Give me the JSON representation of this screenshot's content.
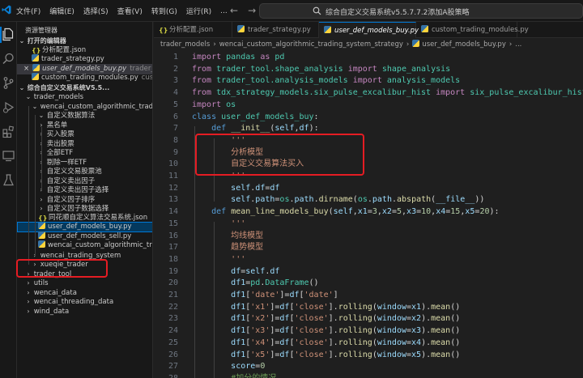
{
  "menu": [
    "文件(F)",
    "编辑(E)",
    "选择(S)",
    "查看(V)",
    "转到(G)",
    "运行(R)",
    "..."
  ],
  "command_center": "综合自定义交易系统v5.5.7.7.2添加A股策略",
  "sidebar": {
    "title": "资源管理器",
    "rows": [
      {
        "kind": "section",
        "chev": "v",
        "label": "打开的编辑器"
      },
      {
        "kind": "open",
        "icon": "json",
        "label": "分析配置.json"
      },
      {
        "kind": "open",
        "icon": "py",
        "label": "trader_strategy.py"
      },
      {
        "kind": "open-active",
        "icon": "py",
        "label": "user_def_models_buy.py",
        "sub": "trader_..."
      },
      {
        "kind": "open",
        "icon": "py",
        "label": "custom_trading_modules.py",
        "sub": "cus..."
      },
      {
        "kind": "section",
        "chev": "v",
        "label": "综合自定义交易系统V5.5..."
      },
      {
        "kind": "folder",
        "level": 1,
        "chev": "v",
        "label": "trader_models"
      },
      {
        "kind": "folder",
        "level": 2,
        "chev": "v",
        "label": "wencai_custom_algorithmic_trading..."
      },
      {
        "kind": "folder",
        "level": 3,
        "chev": "v",
        "label": "自定义数据算法"
      },
      {
        "kind": "folder",
        "level": 3,
        "chev": ">",
        "label": "黑名单"
      },
      {
        "kind": "folder",
        "level": 3,
        "chev": ">",
        "label": "买入股票"
      },
      {
        "kind": "folder",
        "level": 3,
        "chev": ">",
        "label": "卖出股票"
      },
      {
        "kind": "folder",
        "level": 3,
        "chev": ">",
        "label": "全部ETF"
      },
      {
        "kind": "folder",
        "level": 3,
        "chev": ">",
        "label": "剔除一样ETF"
      },
      {
        "kind": "folder",
        "level": 3,
        "chev": ">",
        "label": "自定义交易股票池"
      },
      {
        "kind": "folder",
        "level": 3,
        "chev": ">",
        "label": "自定义卖出因子"
      },
      {
        "kind": "folder",
        "level": 3,
        "chev": ">",
        "label": "自定义卖出因子选择"
      },
      {
        "kind": "folder",
        "level": 3,
        "chev": ">",
        "label": "自定义因子排序"
      },
      {
        "kind": "folder",
        "level": 3,
        "chev": ">",
        "label": "自定义因子数据选择"
      },
      {
        "kind": "file",
        "level": 3,
        "icon": "json",
        "label": "同花顺自定义算法交易系统.json"
      },
      {
        "kind": "file-selected",
        "level": 3,
        "icon": "py",
        "label": "user_def_models_buy.py"
      },
      {
        "kind": "file",
        "level": 3,
        "icon": "py",
        "label": "user_def_models_sell.py"
      },
      {
        "kind": "file",
        "level": 3,
        "icon": "py",
        "label": "wencai_custom_algorithmic_tradin..."
      },
      {
        "kind": "folder",
        "level": 2,
        "chev": ">",
        "label": "wencai_trading_system"
      },
      {
        "kind": "folder",
        "level": 2,
        "chev": ">",
        "label": "xueqie_trader"
      },
      {
        "kind": "folder",
        "level": 1,
        "chev": ">",
        "label": "trader_tool"
      },
      {
        "kind": "folder",
        "level": 1,
        "chev": ">",
        "label": "utils"
      },
      {
        "kind": "folder",
        "level": 1,
        "chev": ">",
        "label": "wencai_data"
      },
      {
        "kind": "folder",
        "level": 1,
        "chev": ">",
        "label": "wencai_threading_data"
      },
      {
        "kind": "folder",
        "level": 1,
        "chev": ">",
        "label": "wind_data"
      }
    ]
  },
  "tabs": [
    {
      "label": "分析配置.json",
      "icon": "json",
      "active": false
    },
    {
      "label": "trader_strategy.py",
      "icon": "py",
      "active": false
    },
    {
      "label": "user_def_models_buy.py",
      "icon": "py",
      "active": true
    },
    {
      "label": "custom_trading_modules.py",
      "icon": "py",
      "active": false
    }
  ],
  "breadcrumb": [
    "trader_models",
    "wencai_custom_algorithmic_trading_system_strategy",
    "user_def_models_buy.py",
    "..."
  ],
  "code": [
    {
      "n": "1",
      "t": [
        [
          "k-purple",
          "import"
        ],
        [
          "k-plain",
          " "
        ],
        [
          "k-cls",
          "pandas"
        ],
        [
          "k-plain",
          " "
        ],
        [
          "k-purple",
          "as"
        ],
        [
          "k-plain",
          " "
        ],
        [
          "k-cls",
          "pd"
        ]
      ]
    },
    {
      "n": "2",
      "t": [
        [
          "k-purple",
          "from"
        ],
        [
          "k-plain",
          " "
        ],
        [
          "k-cls",
          "trader_tool.shape_analysis"
        ],
        [
          "k-plain",
          " "
        ],
        [
          "k-purple",
          "import"
        ],
        [
          "k-plain",
          " "
        ],
        [
          "k-cls",
          "shape_analysis"
        ]
      ]
    },
    {
      "n": "3",
      "t": [
        [
          "k-purple",
          "from"
        ],
        [
          "k-plain",
          " "
        ],
        [
          "k-cls",
          "trader_tool.analysis_models"
        ],
        [
          "k-plain",
          " "
        ],
        [
          "k-purple",
          "import"
        ],
        [
          "k-plain",
          " "
        ],
        [
          "k-cls",
          "analysis_models"
        ]
      ]
    },
    {
      "n": "4",
      "t": [
        [
          "k-purple",
          "from"
        ],
        [
          "k-plain",
          " "
        ],
        [
          "k-cls",
          "tdx_strategy_models.six_pulse_excalibur_hist"
        ],
        [
          "k-plain",
          " "
        ],
        [
          "k-purple",
          "import"
        ],
        [
          "k-plain",
          " "
        ],
        [
          "k-cls",
          "six_pulse_excalibur_hist"
        ]
      ]
    },
    {
      "n": "5",
      "t": [
        [
          "k-purple",
          "import"
        ],
        [
          "k-plain",
          " "
        ],
        [
          "k-cls",
          "os"
        ]
      ]
    },
    {
      "n": "6",
      "t": [
        [
          "k-blue",
          "class"
        ],
        [
          "k-plain",
          " "
        ],
        [
          "k-cls",
          "user_def_models_buy"
        ],
        [
          "k-plain",
          ":"
        ]
      ]
    },
    {
      "n": "7",
      "t": [
        [
          "k-plain",
          "    "
        ],
        [
          "k-blue",
          "def"
        ],
        [
          "k-plain",
          " "
        ],
        [
          "k-fn",
          "__init__"
        ],
        [
          "k-plain",
          "("
        ],
        [
          "k-var",
          "self"
        ],
        [
          "k-plain",
          ","
        ],
        [
          "k-var",
          "df"
        ],
        [
          "k-plain",
          "):"
        ]
      ]
    },
    {
      "n": "8",
      "t": [
        [
          "k-plain",
          "        "
        ],
        [
          "k-str",
          "'''"
        ]
      ]
    },
    {
      "n": "9",
      "t": [
        [
          "k-plain",
          "        "
        ],
        [
          "k-str",
          "分析模型"
        ]
      ]
    },
    {
      "n": "10",
      "t": [
        [
          "k-plain",
          "        "
        ],
        [
          "k-str",
          "自定义交易算法买入"
        ]
      ]
    },
    {
      "n": "11",
      "t": [
        [
          "k-plain",
          "        "
        ],
        [
          "k-str",
          "'''"
        ]
      ]
    },
    {
      "n": "12",
      "t": [
        [
          "k-plain",
          "        "
        ],
        [
          "k-var",
          "self"
        ],
        [
          "k-plain",
          "."
        ],
        [
          "k-var",
          "df"
        ],
        [
          "k-plain",
          "="
        ],
        [
          "k-var",
          "df"
        ]
      ]
    },
    {
      "n": "13",
      "t": [
        [
          "k-plain",
          "        "
        ],
        [
          "k-var",
          "self"
        ],
        [
          "k-plain",
          "."
        ],
        [
          "k-var",
          "path"
        ],
        [
          "k-plain",
          "="
        ],
        [
          "k-cls",
          "os"
        ],
        [
          "k-plain",
          "."
        ],
        [
          "k-var",
          "path"
        ],
        [
          "k-plain",
          "."
        ],
        [
          "k-fn",
          "dirname"
        ],
        [
          "k-plain",
          "("
        ],
        [
          "k-cls",
          "os"
        ],
        [
          "k-plain",
          "."
        ],
        [
          "k-var",
          "path"
        ],
        [
          "k-plain",
          "."
        ],
        [
          "k-fn",
          "abspath"
        ],
        [
          "k-plain",
          "("
        ],
        [
          "k-var",
          "__file__"
        ],
        [
          "k-plain",
          "))"
        ]
      ]
    },
    {
      "n": "14",
      "t": [
        [
          "k-plain",
          "    "
        ],
        [
          "k-blue",
          "def"
        ],
        [
          "k-plain",
          " "
        ],
        [
          "k-fn",
          "mean_line_models_buy"
        ],
        [
          "k-plain",
          "("
        ],
        [
          "k-var",
          "self"
        ],
        [
          "k-plain",
          ","
        ],
        [
          "k-var",
          "x1"
        ],
        [
          "k-plain",
          "="
        ],
        [
          "k-num",
          "3"
        ],
        [
          "k-plain",
          ","
        ],
        [
          "k-var",
          "x2"
        ],
        [
          "k-plain",
          "="
        ],
        [
          "k-num",
          "5"
        ],
        [
          "k-plain",
          ","
        ],
        [
          "k-var",
          "x3"
        ],
        [
          "k-plain",
          "="
        ],
        [
          "k-num",
          "10"
        ],
        [
          "k-plain",
          ","
        ],
        [
          "k-var",
          "x4"
        ],
        [
          "k-plain",
          "="
        ],
        [
          "k-num",
          "15"
        ],
        [
          "k-plain",
          ","
        ],
        [
          "k-var",
          "x5"
        ],
        [
          "k-plain",
          "="
        ],
        [
          "k-num",
          "20"
        ],
        [
          "k-plain",
          "):"
        ]
      ]
    },
    {
      "n": "15",
      "t": [
        [
          "k-plain",
          "        "
        ],
        [
          "k-str",
          "'''"
        ]
      ]
    },
    {
      "n": "16",
      "t": [
        [
          "k-plain",
          "        "
        ],
        [
          "k-str",
          "均线模型"
        ]
      ]
    },
    {
      "n": "17",
      "t": [
        [
          "k-plain",
          "        "
        ],
        [
          "k-str",
          "趋势模型"
        ]
      ]
    },
    {
      "n": "18",
      "t": [
        [
          "k-plain",
          "        "
        ],
        [
          "k-str",
          "'''"
        ]
      ]
    },
    {
      "n": "19",
      "t": [
        [
          "k-plain",
          "        "
        ],
        [
          "k-var",
          "df"
        ],
        [
          "k-plain",
          "="
        ],
        [
          "k-var",
          "self"
        ],
        [
          "k-plain",
          "."
        ],
        [
          "k-var",
          "df"
        ]
      ]
    },
    {
      "n": "20",
      "t": [
        [
          "k-plain",
          "        "
        ],
        [
          "k-var",
          "df1"
        ],
        [
          "k-plain",
          "="
        ],
        [
          "k-cls",
          "pd"
        ],
        [
          "k-plain",
          "."
        ],
        [
          "k-cls",
          "DataFrame"
        ],
        [
          "k-plain",
          "()"
        ]
      ]
    },
    {
      "n": "21",
      "t": [
        [
          "k-plain",
          "        "
        ],
        [
          "k-var",
          "df1"
        ],
        [
          "k-plain",
          "["
        ],
        [
          "k-str",
          "'date'"
        ],
        [
          "k-plain",
          "]="
        ],
        [
          "k-var",
          "df"
        ],
        [
          "k-plain",
          "["
        ],
        [
          "k-str",
          "'date'"
        ],
        [
          "k-plain",
          "]"
        ]
      ]
    },
    {
      "n": "22",
      "t": [
        [
          "k-plain",
          "        "
        ],
        [
          "k-var",
          "df1"
        ],
        [
          "k-plain",
          "["
        ],
        [
          "k-str",
          "'x1'"
        ],
        [
          "k-plain",
          "]="
        ],
        [
          "k-var",
          "df"
        ],
        [
          "k-plain",
          "["
        ],
        [
          "k-str",
          "'close'"
        ],
        [
          "k-plain",
          "]."
        ],
        [
          "k-fn",
          "rolling"
        ],
        [
          "k-plain",
          "("
        ],
        [
          "k-var",
          "window"
        ],
        [
          "k-plain",
          "="
        ],
        [
          "k-var",
          "x1"
        ],
        [
          "k-plain",
          ")."
        ],
        [
          "k-fn",
          "mean"
        ],
        [
          "k-plain",
          "()"
        ]
      ]
    },
    {
      "n": "23",
      "t": [
        [
          "k-plain",
          "        "
        ],
        [
          "k-var",
          "df1"
        ],
        [
          "k-plain",
          "["
        ],
        [
          "k-str",
          "'x2'"
        ],
        [
          "k-plain",
          "]="
        ],
        [
          "k-var",
          "df"
        ],
        [
          "k-plain",
          "["
        ],
        [
          "k-str",
          "'close'"
        ],
        [
          "k-plain",
          "]."
        ],
        [
          "k-fn",
          "rolling"
        ],
        [
          "k-plain",
          "("
        ],
        [
          "k-var",
          "window"
        ],
        [
          "k-plain",
          "="
        ],
        [
          "k-var",
          "x2"
        ],
        [
          "k-plain",
          ")."
        ],
        [
          "k-fn",
          "mean"
        ],
        [
          "k-plain",
          "()"
        ]
      ]
    },
    {
      "n": "24",
      "t": [
        [
          "k-plain",
          "        "
        ],
        [
          "k-var",
          "df1"
        ],
        [
          "k-plain",
          "["
        ],
        [
          "k-str",
          "'x3'"
        ],
        [
          "k-plain",
          "]="
        ],
        [
          "k-var",
          "df"
        ],
        [
          "k-plain",
          "["
        ],
        [
          "k-str",
          "'close'"
        ],
        [
          "k-plain",
          "]."
        ],
        [
          "k-fn",
          "rolling"
        ],
        [
          "k-plain",
          "("
        ],
        [
          "k-var",
          "window"
        ],
        [
          "k-plain",
          "="
        ],
        [
          "k-var",
          "x3"
        ],
        [
          "k-plain",
          ")."
        ],
        [
          "k-fn",
          "mean"
        ],
        [
          "k-plain",
          "()"
        ]
      ]
    },
    {
      "n": "25",
      "t": [
        [
          "k-plain",
          "        "
        ],
        [
          "k-var",
          "df1"
        ],
        [
          "k-plain",
          "["
        ],
        [
          "k-str",
          "'x4'"
        ],
        [
          "k-plain",
          "]="
        ],
        [
          "k-var",
          "df"
        ],
        [
          "k-plain",
          "["
        ],
        [
          "k-str",
          "'close'"
        ],
        [
          "k-plain",
          "]."
        ],
        [
          "k-fn",
          "rolling"
        ],
        [
          "k-plain",
          "("
        ],
        [
          "k-var",
          "window"
        ],
        [
          "k-plain",
          "="
        ],
        [
          "k-var",
          "x4"
        ],
        [
          "k-plain",
          ")."
        ],
        [
          "k-fn",
          "mean"
        ],
        [
          "k-plain",
          "()"
        ]
      ]
    },
    {
      "n": "26",
      "t": [
        [
          "k-plain",
          "        "
        ],
        [
          "k-var",
          "df1"
        ],
        [
          "k-plain",
          "["
        ],
        [
          "k-str",
          "'x5'"
        ],
        [
          "k-plain",
          "]="
        ],
        [
          "k-var",
          "df"
        ],
        [
          "k-plain",
          "["
        ],
        [
          "k-str",
          "'close'"
        ],
        [
          "k-plain",
          "]."
        ],
        [
          "k-fn",
          "rolling"
        ],
        [
          "k-plain",
          "("
        ],
        [
          "k-var",
          "window"
        ],
        [
          "k-plain",
          "="
        ],
        [
          "k-var",
          "x5"
        ],
        [
          "k-plain",
          ")."
        ],
        [
          "k-fn",
          "mean"
        ],
        [
          "k-plain",
          "()"
        ]
      ]
    },
    {
      "n": "27",
      "t": [
        [
          "k-plain",
          "        "
        ],
        [
          "k-var",
          "score"
        ],
        [
          "k-plain",
          "="
        ],
        [
          "k-num",
          "0"
        ]
      ]
    },
    {
      "n": "28",
      "t": [
        [
          "k-plain",
          "        "
        ],
        [
          "k-cmt",
          "#加分的情况"
        ]
      ]
    }
  ]
}
